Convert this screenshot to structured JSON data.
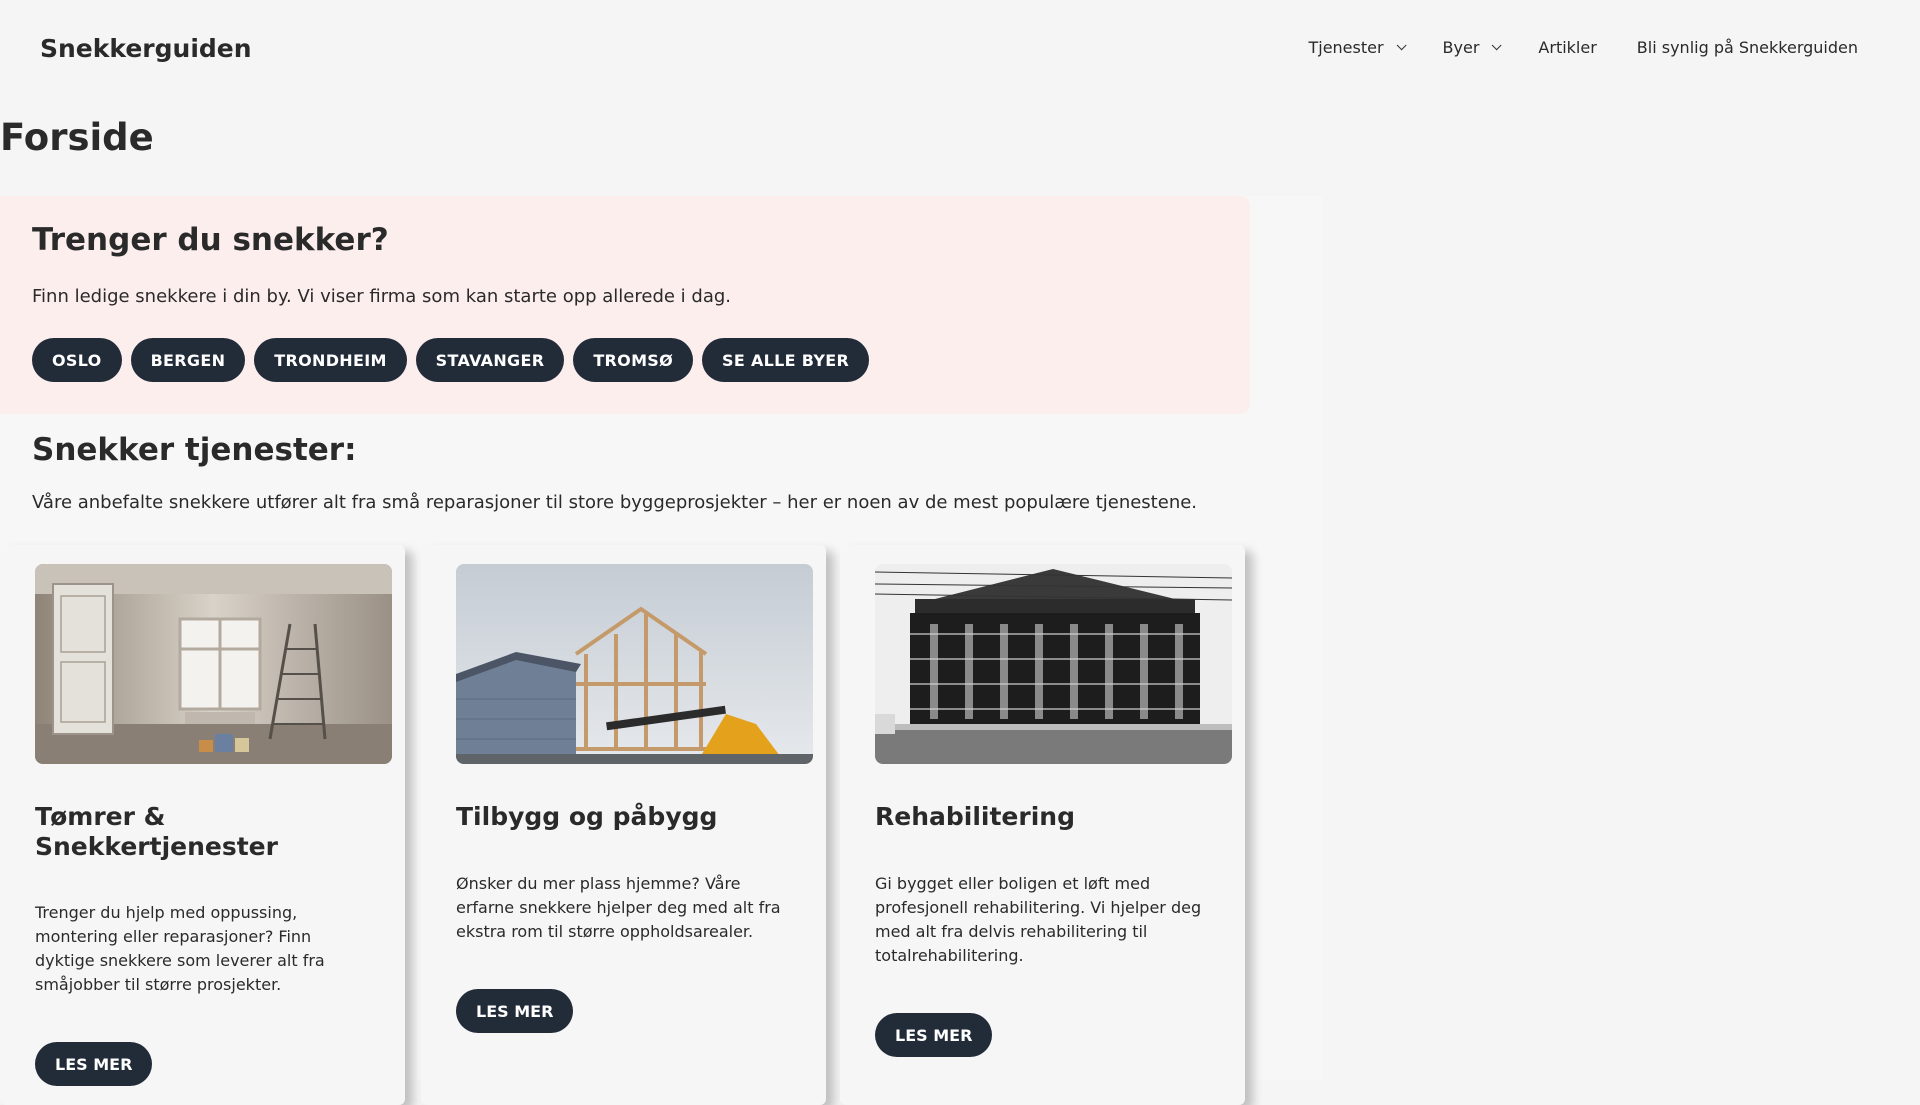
{
  "header": {
    "logo": "Snekkerguiden",
    "nav": [
      {
        "label": "Tjenester",
        "has_dropdown": true
      },
      {
        "label": "Byer",
        "has_dropdown": true
      },
      {
        "label": "Artikler",
        "has_dropdown": false
      },
      {
        "label": "Bli synlig på Snekkerguiden",
        "has_dropdown": false
      }
    ]
  },
  "page": {
    "title": "Forside"
  },
  "hero": {
    "title": "Trenger du snekker?",
    "text": "Finn ledige snekkere i din by. Vi viser firma som kan starte opp allerede i dag.",
    "cities": [
      "OSLO",
      "BERGEN",
      "TRONDHEIM",
      "STAVANGER",
      "TROMSØ",
      "SE ALLE BYER"
    ],
    "background_color": "#fdeeee"
  },
  "services": {
    "title": "Snekker tjenester:",
    "intro": "Våre anbefalte snekkere utfører alt fra små reparasjoner til store byggeprosjekter – her er noen av de mest populære tjenestene.",
    "cards": [
      {
        "title": "Tømrer & Snekkertjenester",
        "text": "Trenger du hjelp med oppussing, montering eller reparasjoner? Finn dyktige snekkere som leverer alt fra småjobber til større prosjekter.",
        "button": "LES MER"
      },
      {
        "title": "Tilbygg og påbygg",
        "text": "Ønsker du mer plass hjemme? Våre erfarne snekkere hjelper deg med alt fra ekstra rom til større oppholdsarealer.",
        "button": "LES MER"
      },
      {
        "title": "Rehabilitering",
        "text": "Gi bygget eller boligen et løft med profesjonell rehabilitering. Vi hjelper deg med alt fra delvis rehabilitering til totalrehabilitering.",
        "button": "LES MER"
      }
    ]
  },
  "colors": {
    "button_bg": "#222b38",
    "page_bg": "#f5f5f5",
    "text": "#2a2a2a"
  }
}
